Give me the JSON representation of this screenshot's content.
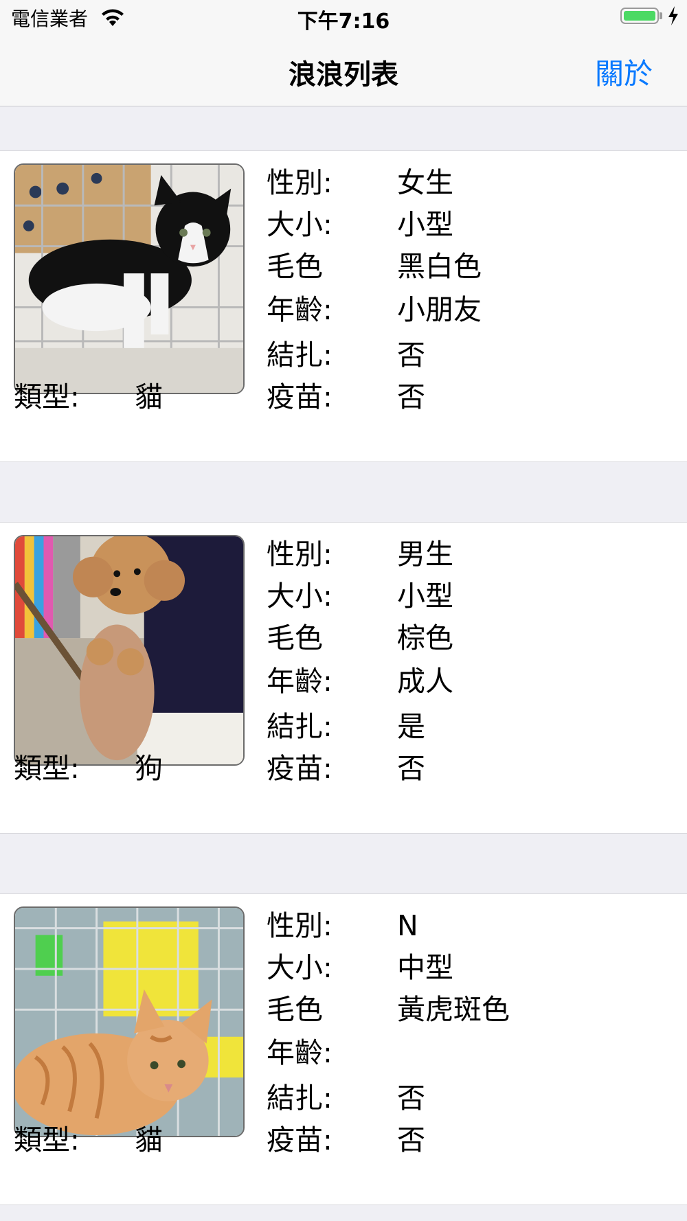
{
  "status_bar": {
    "carrier": "電信業者",
    "time": "下午7:16",
    "battery_percent": 100,
    "battery_color": "#4cd964"
  },
  "nav": {
    "title": "浪浪列表",
    "about_label": "關於",
    "accent_color": "#0a7aff"
  },
  "labels": {
    "gender": "性別:",
    "size": "大小:",
    "color": "毛色",
    "age": "年齡:",
    "neutered": "結扎:",
    "vaccine": "疫苗:",
    "type": "類型:"
  },
  "pets": [
    {
      "gender": "女生",
      "size": "小型",
      "color": "黑白色",
      "age": "小朋友",
      "neutered": "否",
      "vaccine": "否",
      "type": "貓",
      "photo": "black-white-kitten-photo"
    },
    {
      "gender": "男生",
      "size": "小型",
      "color": "棕色",
      "age": "成人",
      "neutered": "是",
      "vaccine": "否",
      "type": "狗",
      "photo": "brown-poodle-photo"
    },
    {
      "gender": "N",
      "size": "中型",
      "color": "黃虎斑色",
      "age": "",
      "neutered": "否",
      "vaccine": "否",
      "type": "貓",
      "photo": "orange-tabby-cat-photo"
    }
  ]
}
